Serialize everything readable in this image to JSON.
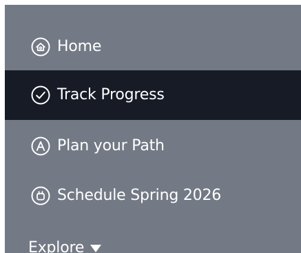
{
  "nav": {
    "items": [
      {
        "label": "Home",
        "icon": "home-icon",
        "active": false
      },
      {
        "label": "Track Progress",
        "icon": "check-circle-icon",
        "active": true
      },
      {
        "label": "Plan your Path",
        "icon": "letter-a-circle-icon",
        "active": false
      },
      {
        "label": "Schedule Spring 2026",
        "icon": "calendar-circle-icon",
        "active": false
      }
    ],
    "explore": {
      "label": "Explore",
      "icon": "caret-down-icon"
    }
  },
  "colors": {
    "sidebar_bg": "#737a85",
    "active_bg": "#161b26",
    "text": "#ffffff"
  }
}
